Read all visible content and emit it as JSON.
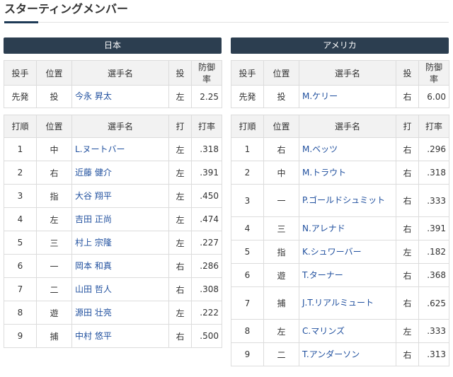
{
  "page": {
    "heading": "スターティングメンバー"
  },
  "pitcher_headers": [
    "投手",
    "位置",
    "選手名",
    "投",
    "防御率"
  ],
  "batting_headers": [
    "打順",
    "位置",
    "選手名",
    "打",
    "打率"
  ],
  "teams": [
    {
      "name": "日本",
      "pitcher": {
        "role": "先発",
        "pos": "投",
        "name": "今永 昇太",
        "hand": "左",
        "era": "2.25"
      },
      "lineup": [
        {
          "order": "1",
          "pos": "中",
          "name": "L.ヌートバー",
          "hand": "左",
          "avg": ".318"
        },
        {
          "order": "2",
          "pos": "右",
          "name": "近藤 健介",
          "hand": "左",
          "avg": ".391"
        },
        {
          "order": "3",
          "pos": "指",
          "name": "大谷 翔平",
          "hand": "左",
          "avg": ".450"
        },
        {
          "order": "4",
          "pos": "左",
          "name": "吉田 正尚",
          "hand": "左",
          "avg": ".474"
        },
        {
          "order": "5",
          "pos": "三",
          "name": "村上 宗隆",
          "hand": "左",
          "avg": ".227"
        },
        {
          "order": "6",
          "pos": "一",
          "name": "岡本 和真",
          "hand": "右",
          "avg": ".286"
        },
        {
          "order": "7",
          "pos": "二",
          "name": "山田 哲人",
          "hand": "右",
          "avg": ".308"
        },
        {
          "order": "8",
          "pos": "遊",
          "name": "源田 壮亮",
          "hand": "左",
          "avg": ".222"
        },
        {
          "order": "9",
          "pos": "捕",
          "name": "中村 悠平",
          "hand": "右",
          "avg": ".500"
        }
      ]
    },
    {
      "name": "アメリカ",
      "pitcher": {
        "role": "先発",
        "pos": "投",
        "name": "M.ケリー",
        "hand": "右",
        "era": "6.00"
      },
      "lineup": [
        {
          "order": "1",
          "pos": "右",
          "name": "M.ベッツ",
          "hand": "右",
          "avg": ".296"
        },
        {
          "order": "2",
          "pos": "中",
          "name": "M.トラウト",
          "hand": "右",
          "avg": ".318"
        },
        {
          "order": "3",
          "pos": "一",
          "name": "P.ゴールドシュミット",
          "hand": "右",
          "avg": ".333"
        },
        {
          "order": "4",
          "pos": "三",
          "name": "N.アレナド",
          "hand": "右",
          "avg": ".391"
        },
        {
          "order": "5",
          "pos": "指",
          "name": "K.シュワーバー",
          "hand": "左",
          "avg": ".182"
        },
        {
          "order": "6",
          "pos": "遊",
          "name": "T.ターナー",
          "hand": "右",
          "avg": ".368"
        },
        {
          "order": "7",
          "pos": "捕",
          "name": "J.T.リアルミュート",
          "hand": "右",
          "avg": ".625"
        },
        {
          "order": "8",
          "pos": "左",
          "name": "C.マリンズ",
          "hand": "左",
          "avg": ".333"
        },
        {
          "order": "9",
          "pos": "二",
          "name": "T.アンダーソン",
          "hand": "右",
          "avg": ".313"
        }
      ]
    }
  ]
}
